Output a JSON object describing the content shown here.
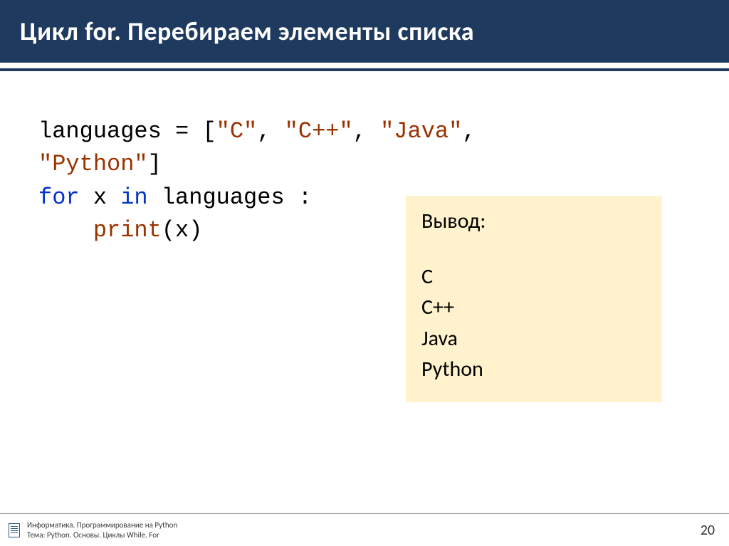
{
  "header": {
    "title": "Цикл for. Перебираем элементы списка"
  },
  "code": {
    "line1_a": "languages = [",
    "line1_b": "\"C\"",
    "line1_c": ", ",
    "line1_d": "\"C++\"",
    "line1_e": ", ",
    "line1_f": "\"Java\"",
    "line1_g": ", ",
    "line2_a": "\"Python\"",
    "line2_b": "]",
    "line3_for": "for",
    "line3_x": " x ",
    "line3_in": "in",
    "line3_lang": " languages :",
    "line4_indent": "",
    "line4_print": "print",
    "line4_paren_open": "(",
    "line4_x": "x",
    "line4_paren_close": ")"
  },
  "output": {
    "title": "Вывод:",
    "lines": [
      "C",
      "C++",
      "Java",
      "Python"
    ]
  },
  "footer": {
    "line1": "Информатика. Программирование на Python",
    "line2": "Тема: Python. Основы. Циклы While. For"
  },
  "page_number": "20"
}
